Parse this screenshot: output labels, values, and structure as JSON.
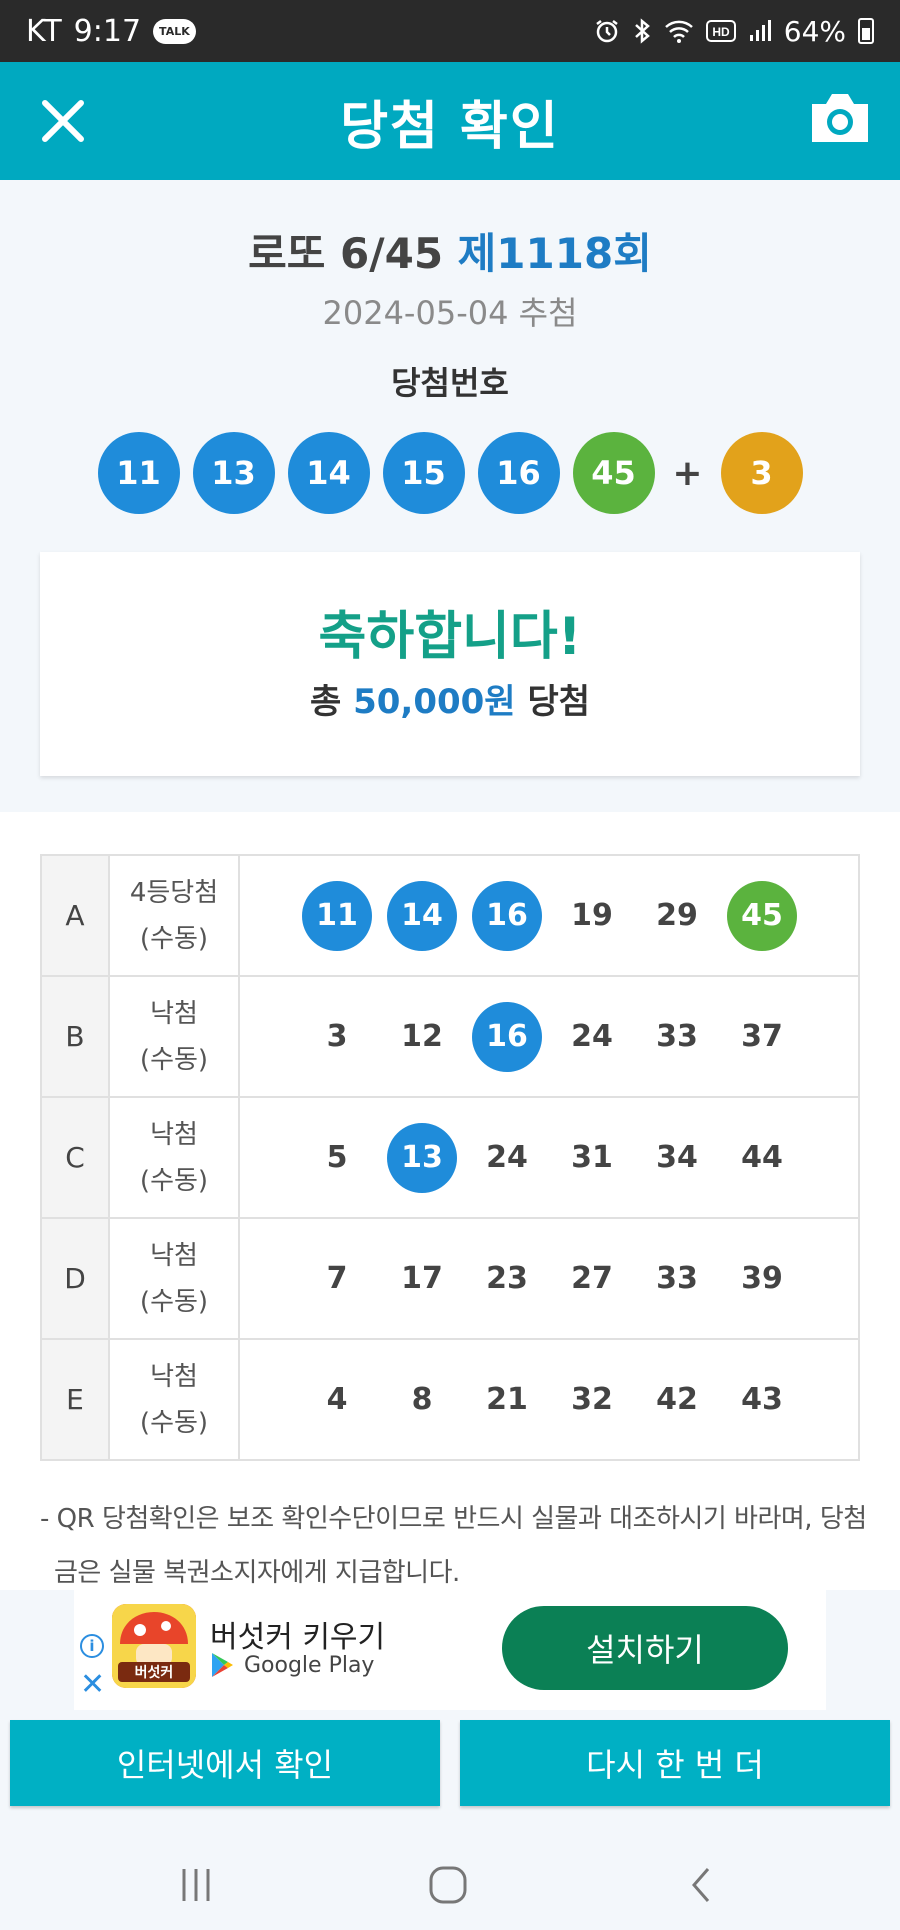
{
  "status_bar": {
    "carrier": "KT",
    "time": "9:17",
    "talk_badge": "TALK",
    "battery": "64%"
  },
  "header": {
    "title": "당첨 확인",
    "close_icon": "close-icon",
    "camera_icon": "camera-icon"
  },
  "draw": {
    "title_prefix": "로또 6/45",
    "round": "제1118회",
    "date": "2024-05-04 추첨",
    "numbers_label": "당첨번호",
    "numbers": [
      "11",
      "13",
      "14",
      "15",
      "16",
      "45"
    ],
    "plus": "+",
    "bonus": "3"
  },
  "result": {
    "congrats": "축하합니다!",
    "total_prefix": "총",
    "amount": "50,000원",
    "total_suffix": "당첨"
  },
  "ticket_rows": [
    {
      "letter": "A",
      "status": "4등당첨",
      "mode": "(수동)",
      "numbers": [
        "11",
        "14",
        "16",
        "19",
        "29",
        "45"
      ],
      "hits": [
        "blue",
        "blue",
        "blue",
        "",
        "",
        "green"
      ]
    },
    {
      "letter": "B",
      "status": "낙첨",
      "mode": "(수동)",
      "numbers": [
        "3",
        "12",
        "16",
        "24",
        "33",
        "37"
      ],
      "hits": [
        "",
        "",
        "blue",
        "",
        "",
        ""
      ]
    },
    {
      "letter": "C",
      "status": "낙첨",
      "mode": "(수동)",
      "numbers": [
        "5",
        "13",
        "24",
        "31",
        "34",
        "44"
      ],
      "hits": [
        "",
        "blue",
        "",
        "",
        "",
        ""
      ]
    },
    {
      "letter": "D",
      "status": "낙첨",
      "mode": "(수동)",
      "numbers": [
        "7",
        "17",
        "23",
        "27",
        "33",
        "39"
      ],
      "hits": [
        "",
        "",
        "",
        "",
        "",
        ""
      ]
    },
    {
      "letter": "E",
      "status": "낙첨",
      "mode": "(수동)",
      "numbers": [
        "4",
        "8",
        "21",
        "32",
        "42",
        "43"
      ],
      "hits": [
        "",
        "",
        "",
        "",
        "",
        ""
      ]
    }
  ],
  "notice": "- QR 당첨확인은 보조 확인수단이므로 반드시 실물과 대조하시기 바라며, 당첨금은 실물 복권소지자에게 지급합니다.",
  "ad": {
    "app_name": "버섯커 키우기",
    "store": "Google Play",
    "install_label": "설치하기",
    "icon_text": "버섯커"
  },
  "buttons": {
    "internet_check": "인터넷에서 확인",
    "again": "다시 한 번 더"
  },
  "colors": {
    "header": "#00a9c0",
    "ball_blue": "#1f8cda",
    "ball_green": "#5bb33e",
    "ball_yellow": "#e2a21b",
    "congrats": "#14a088",
    "install": "#0b8055"
  }
}
